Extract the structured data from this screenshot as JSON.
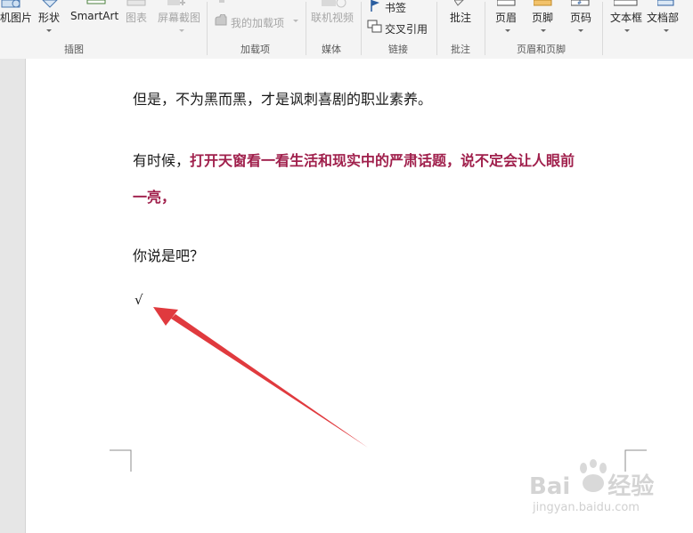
{
  "ribbon": {
    "illustrations": {
      "online_pictures": "机图片",
      "shapes": "形状",
      "smartart": "SmartArt",
      "chart": "图表",
      "screenshot": "屏幕截图",
      "group_label": "插图"
    },
    "addins": {
      "my_addins": "我的加载项",
      "group_label": "加载项"
    },
    "media": {
      "online_video": "联机视频",
      "group_label": "媒体"
    },
    "links": {
      "bookmark": "书签",
      "cross_reference": "交叉引用",
      "group_label": "链接"
    },
    "comments": {
      "comment": "批注",
      "group_label": "批注"
    },
    "header_footer": {
      "header": "页眉",
      "footer": "页脚",
      "page_number": "页码",
      "group_label": "页眉和页脚"
    },
    "text": {
      "text_box": "文本框",
      "document_parts": "文档部"
    }
  },
  "document": {
    "para1": "但是，不为黑而黑，才是讽刺喜剧的职业素养。",
    "para2_lead": "有时候，",
    "para2_bold_line1": "打开天窗看一看生活和现实中的严肃话题，说不定会让人眼前",
    "para2_bold_line2": "一亮，",
    "para3": "你说是吧？",
    "check_mark": "√"
  },
  "watermark": {
    "brand_left": "Bai",
    "brand_right": "经验",
    "url": "jingyan.baidu.com"
  },
  "colors": {
    "highlight_text": "#a0204c",
    "annotation_arrow": "#e03a3e"
  }
}
